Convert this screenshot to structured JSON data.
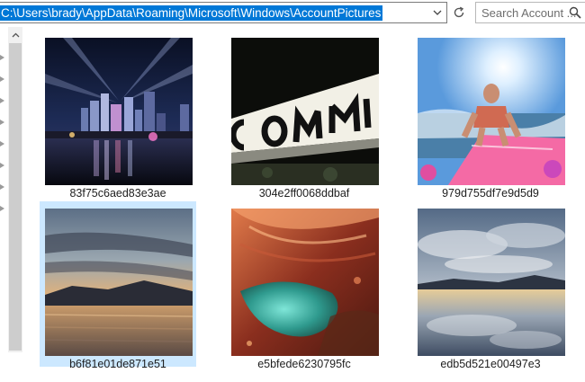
{
  "address_bar": {
    "path": "C:\\Users\\brady\\AppData\\Roaming\\Microsoft\\Windows\\AccountPictures"
  },
  "search": {
    "placeholder": "Search Account ..."
  },
  "files": [
    {
      "name": "83f75c6aed83e3ae",
      "thumbnail": "city-skyline-night-lights",
      "selected": false
    },
    {
      "name": "304e2ff0068ddbaf",
      "thumbnail": "illuminated-letters-sign-night",
      "selected": false
    },
    {
      "name": "979d755df7e9d5d9",
      "thumbnail": "man-surfing-pink-board",
      "selected": false
    },
    {
      "name": "b6f81e01de871e51",
      "thumbnail": "sunset-over-lake",
      "selected": true
    },
    {
      "name": "e5bfede6230795fc",
      "thumbnail": "canyon-green-pool",
      "selected": false
    },
    {
      "name": "edb5d521e00497e3",
      "thumbnail": "cloudy-sky-lake-reflection",
      "selected": false
    }
  ]
}
